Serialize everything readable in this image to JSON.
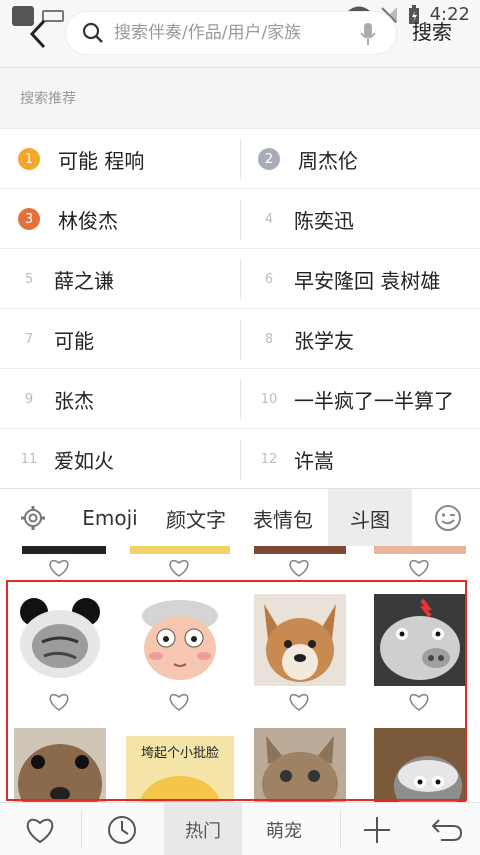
{
  "status_bar": {
    "time": "4:22"
  },
  "search": {
    "placeholder": "搜索伴奏/作品/用户/家族",
    "value": "",
    "button_label": "搜索"
  },
  "recommend": {
    "title": "搜索推荐",
    "items": [
      {
        "rank": "1",
        "text": "可能 程响"
      },
      {
        "rank": "2",
        "text": "周杰伦"
      },
      {
        "rank": "3",
        "text": "林俊杰"
      },
      {
        "rank": "4",
        "text": "陈奕迅"
      },
      {
        "rank": "5",
        "text": "薛之谦"
      },
      {
        "rank": "6",
        "text": "早安隆回 袁树雄"
      },
      {
        "rank": "7",
        "text": "可能"
      },
      {
        "rank": "8",
        "text": "张学友"
      },
      {
        "rank": "9",
        "text": "张杰"
      },
      {
        "rank": "10",
        "text": "一半疯了一半算了"
      },
      {
        "rank": "11",
        "text": "爱如火"
      },
      {
        "rank": "12",
        "text": "许嵩"
      }
    ]
  },
  "keyboard": {
    "tabs": [
      "Emoji",
      "颜文字",
      "表情包",
      "斗图"
    ],
    "active_tab": "斗图",
    "sticker_caption": "垮起个小批脸"
  },
  "bottom_bar": {
    "tabs": [
      "热门",
      "萌宠"
    ],
    "active_tab": "热门"
  },
  "colors": {
    "highlight": "#e32a2a",
    "rank1": "#f4a62a",
    "rank2": "#a6adb6",
    "rank3": "#e4713a"
  }
}
